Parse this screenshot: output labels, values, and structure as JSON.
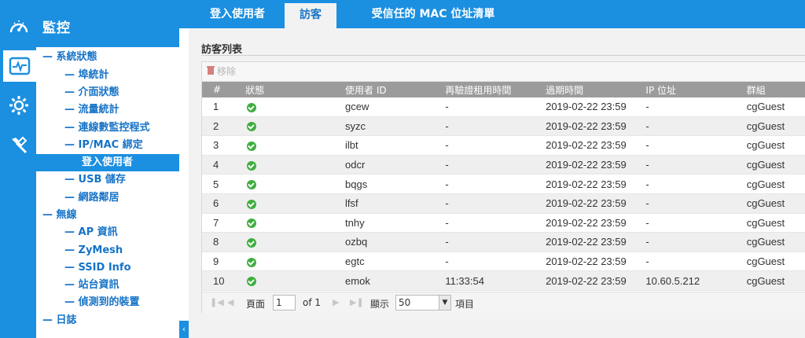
{
  "sidebar": {
    "title": "監控",
    "items": [
      {
        "label": "系統狀態",
        "prefix": "—"
      },
      {
        "label": "埠統計",
        "prefix": "—"
      },
      {
        "label": "介面狀態",
        "prefix": "—"
      },
      {
        "label": "流量統計",
        "prefix": "—"
      },
      {
        "label": "連線數監控程式",
        "prefix": "—"
      },
      {
        "label": "IP/MAC 綁定",
        "prefix": "—"
      },
      {
        "label": "登入使用者",
        "prefix": ""
      },
      {
        "label": "USB 儲存",
        "prefix": "—"
      },
      {
        "label": "網路鄰居",
        "prefix": "—"
      },
      {
        "label": "無線",
        "prefix": "—"
      },
      {
        "label": "AP 資訊",
        "prefix": "—"
      },
      {
        "label": "ZyMesh",
        "prefix": "—"
      },
      {
        "label": "SSID Info",
        "prefix": "—"
      },
      {
        "label": "站台資訊",
        "prefix": "—"
      },
      {
        "label": "偵測到的裝置",
        "prefix": "—"
      },
      {
        "label": "日誌",
        "prefix": "—"
      }
    ],
    "collapse": "‹"
  },
  "tabs": [
    {
      "label": "登入使用者"
    },
    {
      "label": "訪客"
    },
    {
      "label": "受信任的 MAC 位址清單"
    }
  ],
  "section": {
    "title": "訪客列表"
  },
  "toolbar": {
    "remove_label": "移除"
  },
  "table": {
    "headers": [
      "#",
      "狀態",
      "使用者 ID",
      "再驗證租用時間",
      "過期時間",
      "IP 位址",
      "群組"
    ],
    "rows": [
      {
        "n": "1",
        "id": "gcew",
        "reauth": "-",
        "expire": "2019-02-22 23:59",
        "ip": "-",
        "group": "cgGuest"
      },
      {
        "n": "2",
        "id": "syzc",
        "reauth": "-",
        "expire": "2019-02-22 23:59",
        "ip": "-",
        "group": "cgGuest"
      },
      {
        "n": "3",
        "id": "ilbt",
        "reauth": "-",
        "expire": "2019-02-22 23:59",
        "ip": "-",
        "group": "cgGuest"
      },
      {
        "n": "4",
        "id": "odcr",
        "reauth": "-",
        "expire": "2019-02-22 23:59",
        "ip": "-",
        "group": "cgGuest"
      },
      {
        "n": "5",
        "id": "bqgs",
        "reauth": "-",
        "expire": "2019-02-22 23:59",
        "ip": "-",
        "group": "cgGuest"
      },
      {
        "n": "6",
        "id": "lfsf",
        "reauth": "-",
        "expire": "2019-02-22 23:59",
        "ip": "-",
        "group": "cgGuest"
      },
      {
        "n": "7",
        "id": "tnhy",
        "reauth": "-",
        "expire": "2019-02-22 23:59",
        "ip": "-",
        "group": "cgGuest"
      },
      {
        "n": "8",
        "id": "ozbq",
        "reauth": "-",
        "expire": "2019-02-22 23:59",
        "ip": "-",
        "group": "cgGuest"
      },
      {
        "n": "9",
        "id": "egtc",
        "reauth": "-",
        "expire": "2019-02-22 23:59",
        "ip": "-",
        "group": "cgGuest"
      },
      {
        "n": "10",
        "id": "emok",
        "reauth": "11:33:54",
        "expire": "2019-02-22 23:59",
        "ip": "10.60.5.212",
        "group": "cgGuest"
      }
    ]
  },
  "pager": {
    "page_label": "頁面",
    "page_value": "1",
    "of_label": "of 1",
    "show_label": "顯示",
    "show_value": "50",
    "items_label": "項目"
  },
  "colors": {
    "accent": "#1b8fe0",
    "status_ok": "#3fae3f"
  }
}
